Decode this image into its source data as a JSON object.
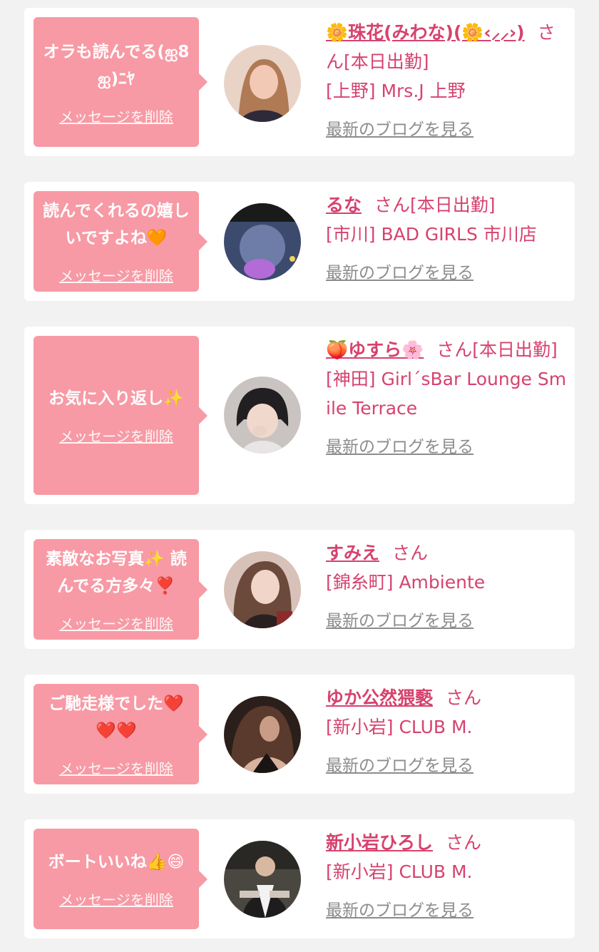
{
  "delete_label": "メッセージを削除",
  "blog_label": "最新のブログを見る",
  "san_suffix": "さん",
  "cards": [
    {
      "message": "オラも読んでる(ஐ8ஐ)ﾆﾔ",
      "name": "🌼珠花(みわな)(🌼‹⸝⸝›)",
      "status": "[本日出勤]",
      "shop": "[上野] Mrs.J 上野"
    },
    {
      "message": "読んでくれるの嬉しいですよね🧡",
      "name": "るな",
      "status": "[本日出勤]",
      "shop": "[市川] BAD GIRLS 市川店"
    },
    {
      "message": "お気に入り返し✨",
      "name": "🍑ゆすら🌸",
      "status": "[本日出勤]",
      "shop": "[神田] Girl´sBar Lounge Smile Terrace"
    },
    {
      "message": "素敵なお写真✨ 読んでる方多々❣️",
      "name": "すみえ",
      "status": "",
      "shop": "[錦糸町] Ambiente"
    },
    {
      "message": "ご馳走様でした❤️❤️❤️",
      "name": "ゆか公然猥褻",
      "status": "",
      "shop": "[新小岩] CLUB M."
    },
    {
      "message": "ボートいいね👍😄",
      "name": "新小岩ひろし",
      "status": "",
      "shop": "[新小岩] CLUB M."
    }
  ],
  "avatar_colors": [
    "#d9a48b",
    "#3c4a6e",
    "#c9c4c2",
    "#6b4a3c",
    "#2b1f1b",
    "#4a4740"
  ]
}
